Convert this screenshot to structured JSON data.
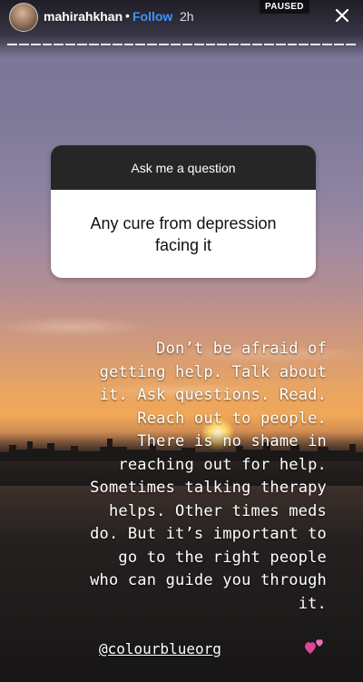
{
  "header": {
    "username": "mahirahkhan",
    "separator": "•",
    "follow_label": "Follow",
    "time_ago": "2h",
    "paused_label": "PAUSED"
  },
  "progress": {
    "segments": 30,
    "current": 1
  },
  "question_sticker": {
    "heading": "Ask me a question",
    "question": "Any cure from depression facing it"
  },
  "story_text": {
    "lines": [
      "Don’t be afraid of",
      "getting help. Talk about",
      "it. Ask questions. Read.",
      "Reach out to people.",
      "There is no shame in",
      "reaching out for help.",
      "Sometimes talking therapy",
      "helps. Other times meds",
      "do. But it’s important to",
      "go to the right people",
      "who can guide you through",
      "it."
    ]
  },
  "mention": "@colourblueorg",
  "icons": {
    "close": "close-icon",
    "hearts": "two-hearts-icon"
  },
  "colors": {
    "follow": "#3e94ff",
    "sticker_header": "#262626",
    "hearts": "#e0459b"
  }
}
